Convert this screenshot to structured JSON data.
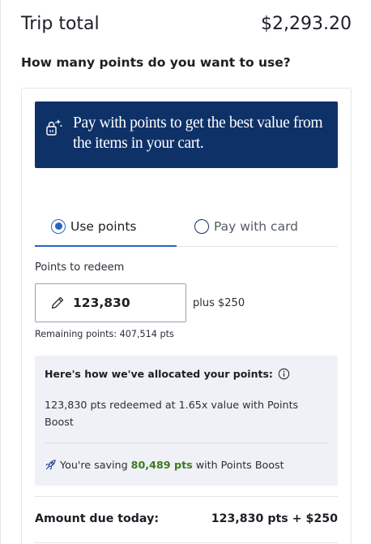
{
  "trip": {
    "title": "Trip total",
    "amount": "$2,293.20"
  },
  "question": "How many points do you want to use?",
  "promo": {
    "icon": "sparkle-bag-icon",
    "text": "Pay with points to get the best value from the items in your cart."
  },
  "tabs": [
    {
      "label": "Use points",
      "selected": true
    },
    {
      "label": "Pay with card",
      "selected": false
    }
  ],
  "redeem": {
    "label": "Points to redeem",
    "value": "123,830",
    "plus_cash": "plus $250",
    "remaining": "Remaining points:  407,514 pts"
  },
  "allocation": {
    "heading": "Here's how we've allocated your points:",
    "detail": "123,830 pts redeemed at 1.65x value with Points Boost",
    "saving_prefix": "You're saving",
    "saving_points": "80,489 pts",
    "saving_suffix": "with Points Boost"
  },
  "due": {
    "label": "Amount due today:",
    "value": "123,830 pts + $250"
  },
  "colors": {
    "brand_navy": "#0e3168",
    "accent_blue": "#2b63c4",
    "saving_green": "#3d7a1f",
    "panel_bg": "#eff1f7"
  }
}
